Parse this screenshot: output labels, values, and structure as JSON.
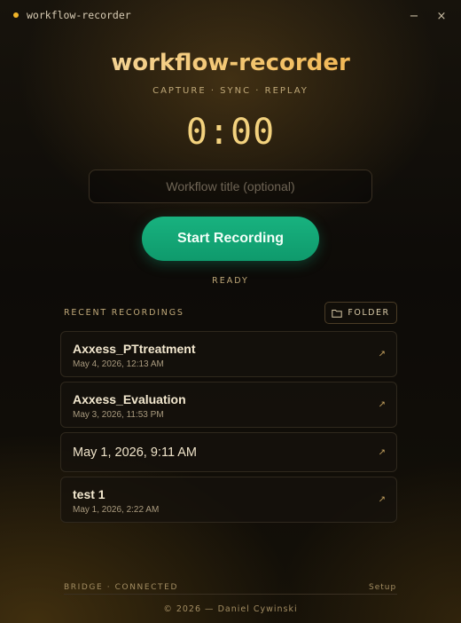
{
  "window": {
    "title": "workflow-recorder",
    "minimize_glyph": "−",
    "close_glyph": "×"
  },
  "header": {
    "brand": "workflow-recorder",
    "tagline": "CAPTURE · SYNC · REPLAY"
  },
  "recorder": {
    "timer": "0:00",
    "title_placeholder": "Workflow title (optional)",
    "title_value": "",
    "start_label": "Start Recording",
    "status": "READY"
  },
  "recent": {
    "label": "RECENT RECORDINGS",
    "folder_label": "FOLDER",
    "open_glyph": "↗",
    "items": [
      {
        "name": "Axxess_PTtreatment",
        "date": "May 4, 2026, 12:13 AM"
      },
      {
        "name": "Axxess_Evaluation",
        "date": "May 3, 2026, 11:53 PM"
      },
      {
        "name": "May 1, 2026, 9:11 AM",
        "date": ""
      },
      {
        "name": "test 1",
        "date": "May 1, 2026, 2:22 AM"
      }
    ]
  },
  "footer": {
    "bridge_status": "BRIDGE · CONNECTED",
    "setup_label": "Setup",
    "copyright": "© 2026 — Daniel Cywinski"
  },
  "colors": {
    "accent_gold": "#f3c56e",
    "start_green": "#13a877",
    "status_dot": "#f0b429"
  },
  "icons": [
    "status-dot-icon",
    "minimize-icon",
    "close-icon",
    "folder-icon",
    "open-external-icon"
  ]
}
